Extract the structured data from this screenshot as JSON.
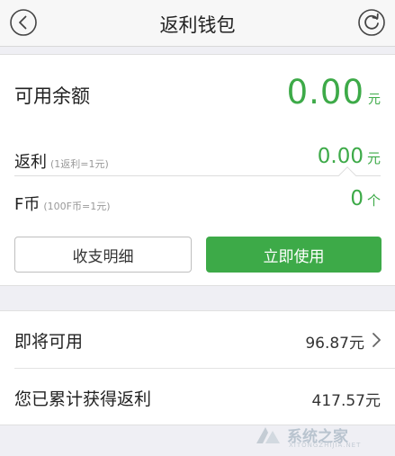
{
  "header": {
    "title": "返利钱包",
    "back_icon": "back-circle-icon",
    "refresh_icon": "refresh-circle-icon"
  },
  "balance": {
    "label": "可用余额",
    "value": "0.00",
    "unit": "元"
  },
  "rebate": {
    "label": "返利",
    "hint": "(1返利=1元)",
    "value": "0.00",
    "unit": "元"
  },
  "fcoin": {
    "label": "F币",
    "hint": "(100F币=1元)",
    "value": "0",
    "unit": "个"
  },
  "actions": {
    "details_label": "收支明细",
    "use_label": "立即使用"
  },
  "list": {
    "upcoming_label": "即将可用",
    "upcoming_value": "96.87元",
    "total_label": "您已累计获得返利",
    "total_value": "417.57元"
  },
  "watermark": {
    "text": "系统之家",
    "sub": "XITONGZHIJIA.NET"
  },
  "colors": {
    "accent": "#3daa48",
    "background": "#efeff4"
  }
}
